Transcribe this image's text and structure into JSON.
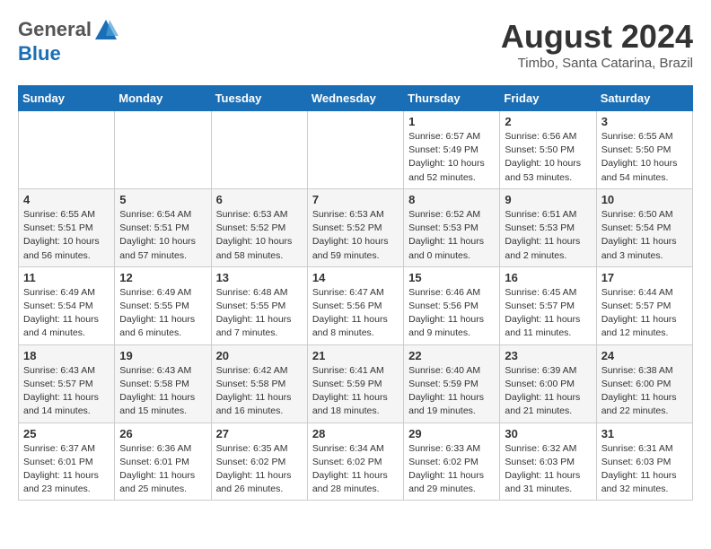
{
  "header": {
    "logo_general": "General",
    "logo_blue": "Blue",
    "month_year": "August 2024",
    "location": "Timbo, Santa Catarina, Brazil"
  },
  "weekdays": [
    "Sunday",
    "Monday",
    "Tuesday",
    "Wednesday",
    "Thursday",
    "Friday",
    "Saturday"
  ],
  "weeks": [
    [
      {
        "day": "",
        "info": ""
      },
      {
        "day": "",
        "info": ""
      },
      {
        "day": "",
        "info": ""
      },
      {
        "day": "",
        "info": ""
      },
      {
        "day": "1",
        "info": "Sunrise: 6:57 AM\nSunset: 5:49 PM\nDaylight: 10 hours\nand 52 minutes."
      },
      {
        "day": "2",
        "info": "Sunrise: 6:56 AM\nSunset: 5:50 PM\nDaylight: 10 hours\nand 53 minutes."
      },
      {
        "day": "3",
        "info": "Sunrise: 6:55 AM\nSunset: 5:50 PM\nDaylight: 10 hours\nand 54 minutes."
      }
    ],
    [
      {
        "day": "4",
        "info": "Sunrise: 6:55 AM\nSunset: 5:51 PM\nDaylight: 10 hours\nand 56 minutes."
      },
      {
        "day": "5",
        "info": "Sunrise: 6:54 AM\nSunset: 5:51 PM\nDaylight: 10 hours\nand 57 minutes."
      },
      {
        "day": "6",
        "info": "Sunrise: 6:53 AM\nSunset: 5:52 PM\nDaylight: 10 hours\nand 58 minutes."
      },
      {
        "day": "7",
        "info": "Sunrise: 6:53 AM\nSunset: 5:52 PM\nDaylight: 10 hours\nand 59 minutes."
      },
      {
        "day": "8",
        "info": "Sunrise: 6:52 AM\nSunset: 5:53 PM\nDaylight: 11 hours\nand 0 minutes."
      },
      {
        "day": "9",
        "info": "Sunrise: 6:51 AM\nSunset: 5:53 PM\nDaylight: 11 hours\nand 2 minutes."
      },
      {
        "day": "10",
        "info": "Sunrise: 6:50 AM\nSunset: 5:54 PM\nDaylight: 11 hours\nand 3 minutes."
      }
    ],
    [
      {
        "day": "11",
        "info": "Sunrise: 6:49 AM\nSunset: 5:54 PM\nDaylight: 11 hours\nand 4 minutes."
      },
      {
        "day": "12",
        "info": "Sunrise: 6:49 AM\nSunset: 5:55 PM\nDaylight: 11 hours\nand 6 minutes."
      },
      {
        "day": "13",
        "info": "Sunrise: 6:48 AM\nSunset: 5:55 PM\nDaylight: 11 hours\nand 7 minutes."
      },
      {
        "day": "14",
        "info": "Sunrise: 6:47 AM\nSunset: 5:56 PM\nDaylight: 11 hours\nand 8 minutes."
      },
      {
        "day": "15",
        "info": "Sunrise: 6:46 AM\nSunset: 5:56 PM\nDaylight: 11 hours\nand 9 minutes."
      },
      {
        "day": "16",
        "info": "Sunrise: 6:45 AM\nSunset: 5:57 PM\nDaylight: 11 hours\nand 11 minutes."
      },
      {
        "day": "17",
        "info": "Sunrise: 6:44 AM\nSunset: 5:57 PM\nDaylight: 11 hours\nand 12 minutes."
      }
    ],
    [
      {
        "day": "18",
        "info": "Sunrise: 6:43 AM\nSunset: 5:57 PM\nDaylight: 11 hours\nand 14 minutes."
      },
      {
        "day": "19",
        "info": "Sunrise: 6:43 AM\nSunset: 5:58 PM\nDaylight: 11 hours\nand 15 minutes."
      },
      {
        "day": "20",
        "info": "Sunrise: 6:42 AM\nSunset: 5:58 PM\nDaylight: 11 hours\nand 16 minutes."
      },
      {
        "day": "21",
        "info": "Sunrise: 6:41 AM\nSunset: 5:59 PM\nDaylight: 11 hours\nand 18 minutes."
      },
      {
        "day": "22",
        "info": "Sunrise: 6:40 AM\nSunset: 5:59 PM\nDaylight: 11 hours\nand 19 minutes."
      },
      {
        "day": "23",
        "info": "Sunrise: 6:39 AM\nSunset: 6:00 PM\nDaylight: 11 hours\nand 21 minutes."
      },
      {
        "day": "24",
        "info": "Sunrise: 6:38 AM\nSunset: 6:00 PM\nDaylight: 11 hours\nand 22 minutes."
      }
    ],
    [
      {
        "day": "25",
        "info": "Sunrise: 6:37 AM\nSunset: 6:01 PM\nDaylight: 11 hours\nand 23 minutes."
      },
      {
        "day": "26",
        "info": "Sunrise: 6:36 AM\nSunset: 6:01 PM\nDaylight: 11 hours\nand 25 minutes."
      },
      {
        "day": "27",
        "info": "Sunrise: 6:35 AM\nSunset: 6:02 PM\nDaylight: 11 hours\nand 26 minutes."
      },
      {
        "day": "28",
        "info": "Sunrise: 6:34 AM\nSunset: 6:02 PM\nDaylight: 11 hours\nand 28 minutes."
      },
      {
        "day": "29",
        "info": "Sunrise: 6:33 AM\nSunset: 6:02 PM\nDaylight: 11 hours\nand 29 minutes."
      },
      {
        "day": "30",
        "info": "Sunrise: 6:32 AM\nSunset: 6:03 PM\nDaylight: 11 hours\nand 31 minutes."
      },
      {
        "day": "31",
        "info": "Sunrise: 6:31 AM\nSunset: 6:03 PM\nDaylight: 11 hours\nand 32 minutes."
      }
    ]
  ]
}
